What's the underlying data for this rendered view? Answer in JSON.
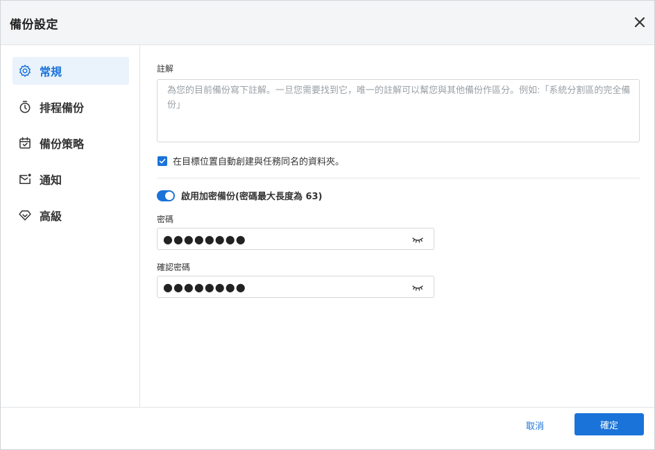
{
  "dialog": {
    "title": "備份設定",
    "close_icon": "close-icon"
  },
  "sidebar": {
    "items": [
      {
        "label": "常規",
        "icon": "gear-icon",
        "active": true
      },
      {
        "label": "排程備份",
        "icon": "timer-icon",
        "active": false
      },
      {
        "label": "備份策略",
        "icon": "calendar-check-icon",
        "active": false
      },
      {
        "label": "通知",
        "icon": "mail-notification-icon",
        "active": false
      },
      {
        "label": "高級",
        "icon": "diamond-icon",
        "active": false
      }
    ]
  },
  "general": {
    "note_label": "註解",
    "note_placeholder": "為您的目前備份寫下註解。一旦您需要找到它，唯一的註解可以幫您與其他備份作區分。例如:「系統分割區的完全備份」",
    "note_value": "",
    "create_folder_label": "在目標位置自動創建與任務同名的資料夾。",
    "create_folder_checked": true,
    "encryption_label": "啟用加密備份(密碼最大長度為 63)",
    "encryption_enabled": true,
    "password_label": "密碼",
    "password_value": "●●●●●●●●",
    "confirm_password_label": "確認密碼",
    "confirm_password_value": "●●●●●●●●"
  },
  "footer": {
    "cancel_label": "取消",
    "ok_label": "確定"
  },
  "colors": {
    "accent": "#1a73d9",
    "active_bg": "#eaf2fb",
    "header_bg": "#f4f5f7"
  }
}
